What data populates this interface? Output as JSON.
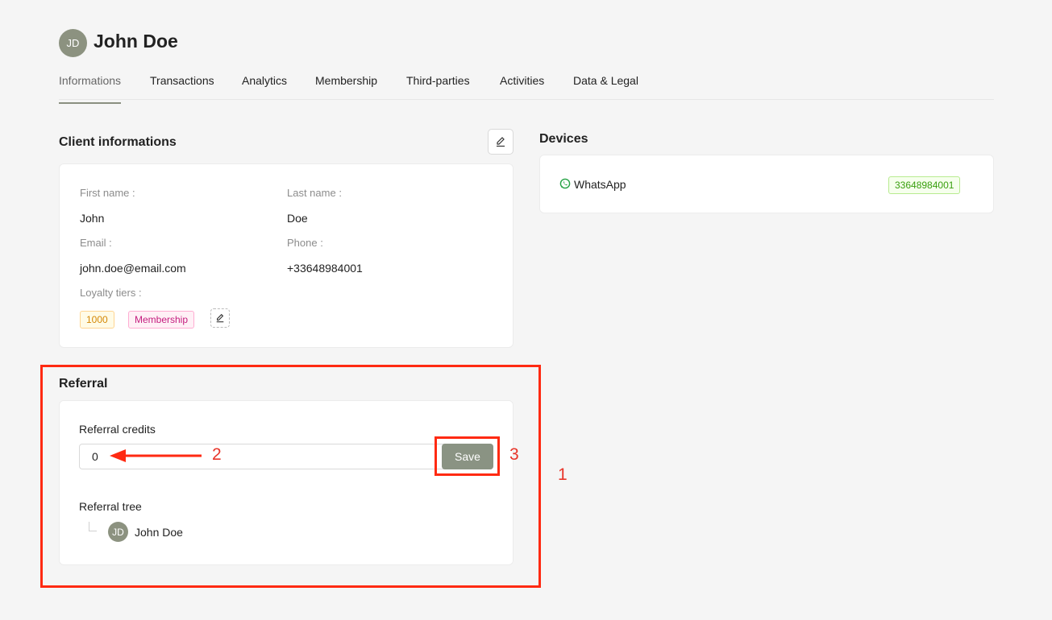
{
  "header": {
    "avatar_initials": "JD",
    "name": "John Doe"
  },
  "tabs": [
    {
      "label": "Informations",
      "active": true
    },
    {
      "label": "Transactions",
      "active": false
    },
    {
      "label": "Analytics",
      "active": false
    },
    {
      "label": "Membership",
      "active": false
    },
    {
      "label": "Third-parties",
      "active": false
    },
    {
      "label": "Activities",
      "active": false
    },
    {
      "label": "Data & Legal",
      "active": false
    }
  ],
  "client": {
    "title": "Client informations",
    "first_name_label": "First name :",
    "first_name": "John",
    "last_name_label": "Last name :",
    "last_name": "Doe",
    "email_label": "Email :",
    "email": "john.doe@email.com",
    "phone_label": "Phone :",
    "phone": "+33648984001",
    "loyalty_label": "Loyalty tiers :",
    "loyalty_points": "1000",
    "loyalty_tier": "Membership"
  },
  "devices": {
    "title": "Devices",
    "items": [
      {
        "icon": "whatsapp-icon",
        "name": "WhatsApp",
        "number": "33648984001"
      }
    ]
  },
  "referral": {
    "title": "Referral",
    "credits_label": "Referral credits",
    "credits_value": "0",
    "save_label": "Save",
    "tree_label": "Referral tree",
    "tree": [
      {
        "initials": "JD",
        "name": "John Doe"
      }
    ]
  },
  "annotations": {
    "n1": "1",
    "n2": "2",
    "n3": "3"
  },
  "colors": {
    "accent": "#8a9383",
    "annotation": "#ff2a12",
    "background": "#f5f5f5"
  }
}
